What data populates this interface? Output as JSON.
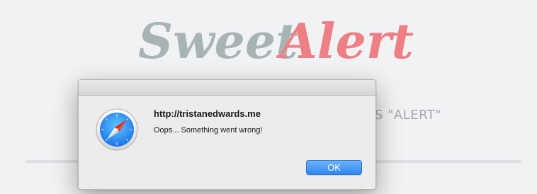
{
  "background": {
    "logo": {
      "word1": "Sweet",
      "word2": "Alert",
      "word1_color": "#a8b3b5",
      "word2_color": "#ee7f85"
    },
    "tagline_visible_fragment": "T'S \"ALERT\""
  },
  "dialog": {
    "title": "http://tristanedwards.me",
    "message": "Oops... Something went wrong!",
    "ok_label": "OK",
    "icon": "safari-compass-icon",
    "accent_color": "#2e86f2"
  }
}
